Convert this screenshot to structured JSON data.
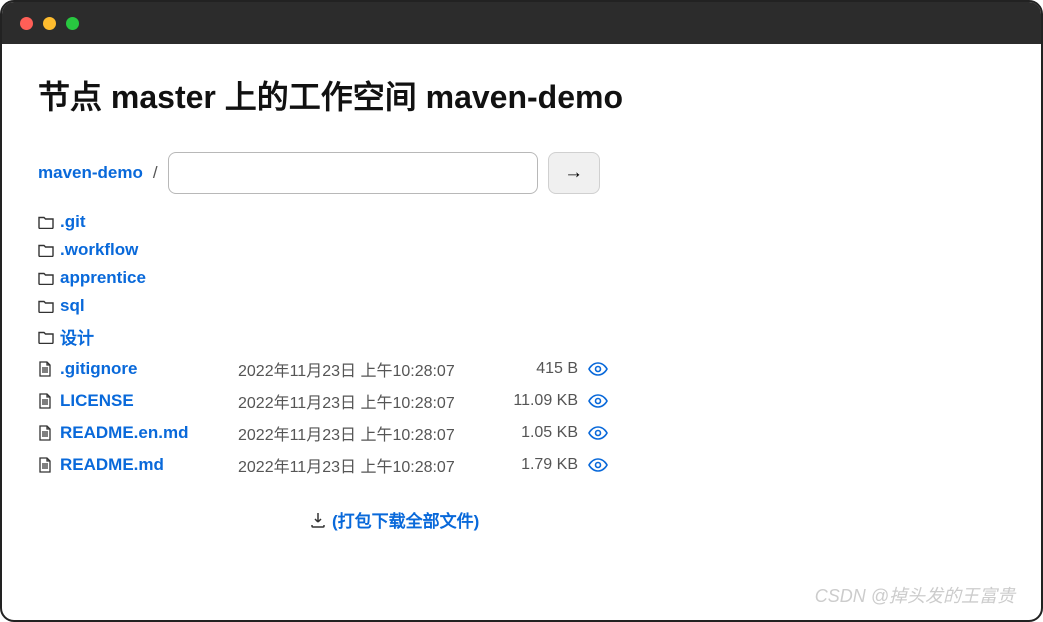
{
  "header": {
    "title": "节点 master 上的工作空间 maven-demo"
  },
  "breadcrumb": {
    "root": "maven-demo",
    "separator": "/",
    "input_value": "",
    "go_label": "→"
  },
  "files": {
    "folders": [
      {
        "name": ".git"
      },
      {
        "name": ".workflow"
      },
      {
        "name": "apprentice"
      },
      {
        "name": "sql"
      },
      {
        "name": "设计"
      }
    ],
    "items": [
      {
        "name": ".gitignore",
        "date": "2022年11月23日 上午10:28:07",
        "size": "415 B"
      },
      {
        "name": "LICENSE",
        "date": "2022年11月23日 上午10:28:07",
        "size": "11.09 KB"
      },
      {
        "name": "README.en.md",
        "date": "2022年11月23日 上午10:28:07",
        "size": "1.05 KB"
      },
      {
        "name": "README.md",
        "date": "2022年11月23日 上午10:28:07",
        "size": "1.79 KB"
      }
    ]
  },
  "download": {
    "label": "(打包下载全部文件)"
  },
  "watermark": "CSDN @掉头发的王富贵"
}
